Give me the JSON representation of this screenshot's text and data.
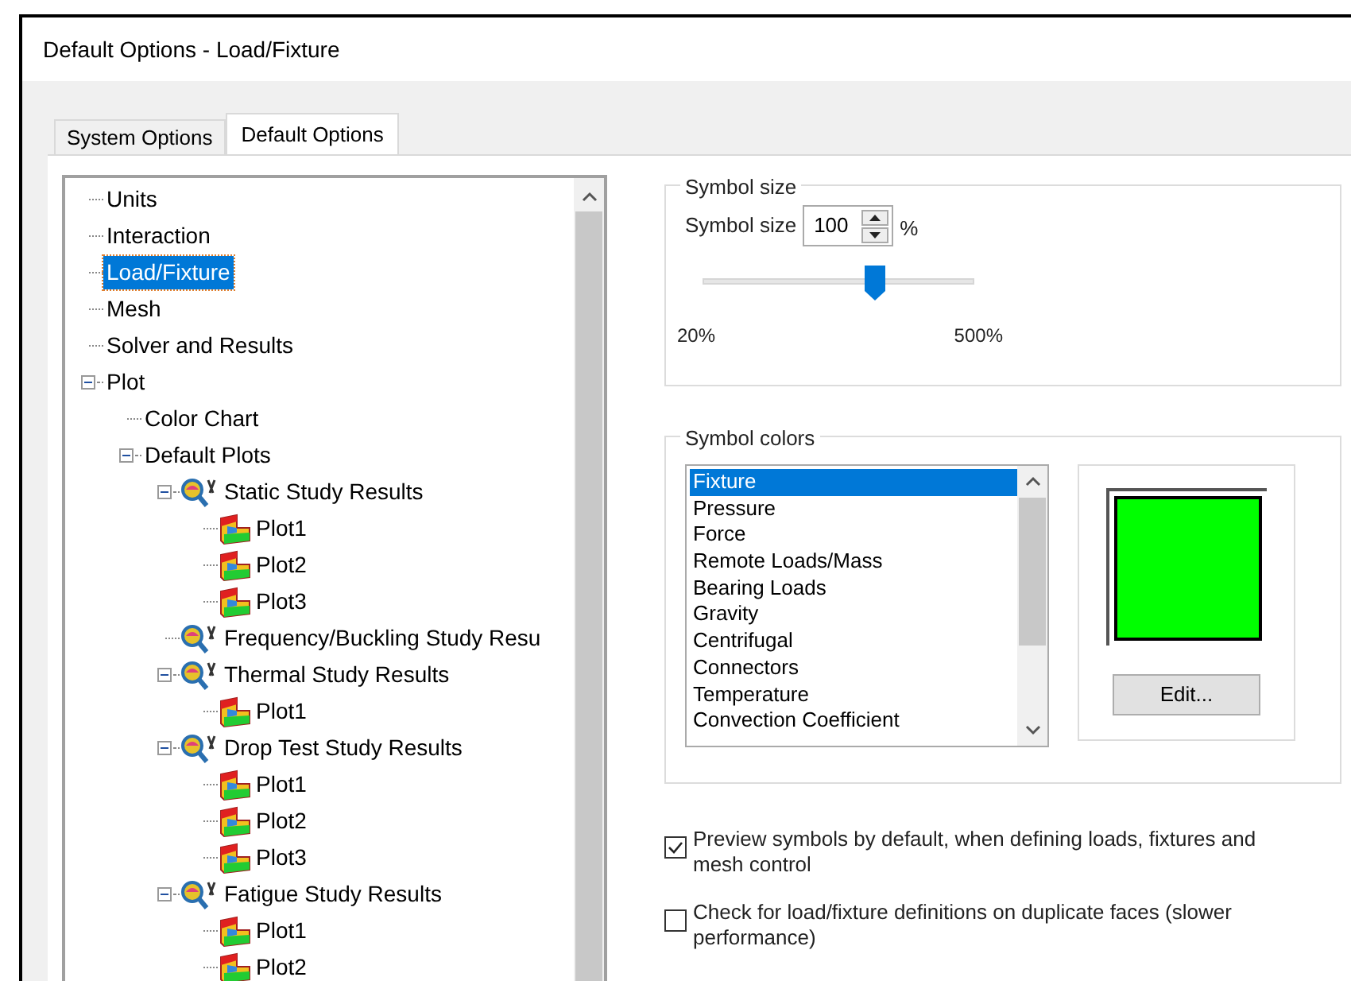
{
  "window": {
    "title": "Default Options - Load/Fixture"
  },
  "tabs": [
    {
      "label": "System Options",
      "selected": false
    },
    {
      "label": "Default Options",
      "selected": true
    }
  ],
  "tree": [
    {
      "label": "Units",
      "selected": false
    },
    {
      "label": "Interaction",
      "selected": false
    },
    {
      "label": "Load/Fixture",
      "selected": true
    },
    {
      "label": "Mesh",
      "selected": false
    },
    {
      "label": "Solver and Results",
      "selected": false
    },
    {
      "label": "Plot",
      "selected": false,
      "expanded": true,
      "children": [
        {
          "label": "Color Chart",
          "selected": false
        },
        {
          "label": "Default Plots",
          "selected": false,
          "expanded": true,
          "children": [
            {
              "label": "Static Study Results",
              "kind": "study",
              "selected": false,
              "expanded": true,
              "children": [
                {
                  "label": "Plot1",
                  "kind": "plot",
                  "selected": false
                },
                {
                  "label": "Plot2",
                  "kind": "plot",
                  "selected": false
                },
                {
                  "label": "Plot3",
                  "kind": "plot",
                  "selected": false
                }
              ]
            },
            {
              "label": "Frequency/Buckling Study Resu",
              "kind": "study",
              "selected": false
            },
            {
              "label": "Thermal Study Results",
              "kind": "study",
              "selected": false,
              "expanded": true,
              "children": [
                {
                  "label": "Plot1",
                  "kind": "plot",
                  "selected": false
                }
              ]
            },
            {
              "label": "Drop Test Study Results",
              "kind": "study",
              "selected": false,
              "expanded": true,
              "children": [
                {
                  "label": "Plot1",
                  "kind": "plot",
                  "selected": false
                },
                {
                  "label": "Plot2",
                  "kind": "plot",
                  "selected": false
                },
                {
                  "label": "Plot3",
                  "kind": "plot",
                  "selected": false
                }
              ]
            },
            {
              "label": "Fatigue Study Results",
              "kind": "study",
              "selected": false,
              "expanded": true,
              "children": [
                {
                  "label": "Plot1",
                  "kind": "plot",
                  "selected": false
                },
                {
                  "label": "Plot2",
                  "kind": "plot",
                  "selected": false
                }
              ]
            }
          ]
        }
      ]
    }
  ],
  "symbol_size": {
    "group_title": "Symbol size",
    "label": "Symbol size",
    "value": "100",
    "unit": "%",
    "level": 0.65,
    "min_label": "20%",
    "max_label": "500%"
  },
  "symbol_colors": {
    "group_title": "Symbol colors",
    "items": [
      {
        "label": "Fixture",
        "selected": true
      },
      {
        "label": "Pressure",
        "selected": false
      },
      {
        "label": "Force",
        "selected": false
      },
      {
        "label": "Remote Loads/Mass",
        "selected": false
      },
      {
        "label": "Bearing Loads",
        "selected": false
      },
      {
        "label": "Gravity",
        "selected": false
      },
      {
        "label": "Centrifugal",
        "selected": false
      },
      {
        "label": "Connectors",
        "selected": false
      },
      {
        "label": "Temperature",
        "selected": false
      },
      {
        "label": "Convection Coefficient",
        "selected": false
      }
    ],
    "color": "#00ff00",
    "edit_button": "Edit..."
  },
  "checkboxes": [
    {
      "label": "Preview symbols by default, when defining loads, fixtures and mesh control",
      "checked": true
    },
    {
      "label": "Check for load/fixture definitions on duplicate faces (slower performance)",
      "checked": false
    }
  ]
}
